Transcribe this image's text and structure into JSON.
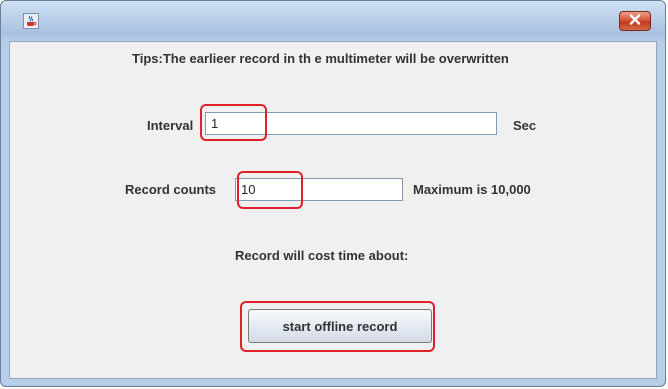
{
  "window": {
    "app_icon": "java-cup-icon",
    "close_icon": "close-icon"
  },
  "tips": "Tips:The earlieer record in th e multimeter will be overwritten",
  "interval": {
    "label": "Interval",
    "value": "1",
    "unit": "Sec"
  },
  "record_counts": {
    "label": "Record counts",
    "value": "10",
    "hint": "Maximum is 10,000"
  },
  "cost_time": {
    "label": "Record will cost time about:"
  },
  "start_button": {
    "label": "start offline record"
  },
  "colors": {
    "highlight": "#e0202a",
    "close_button": "#c23a1c",
    "background": "#f0f0f0"
  }
}
